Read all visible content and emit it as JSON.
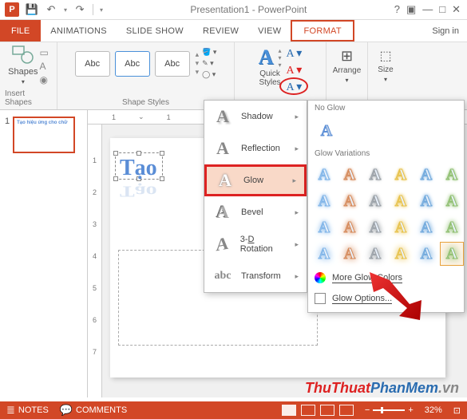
{
  "title": "Presentation1 - PowerPoint",
  "tabs": {
    "file": "FILE",
    "animations": "ANIMATIONS",
    "slideshow": "SLIDE SHOW",
    "review": "REVIEW",
    "view": "VIEW",
    "format": "FORMAT",
    "signin": "Sign in"
  },
  "ribbon": {
    "insert_shapes": "Insert Shapes",
    "shapes": "Shapes",
    "shape_styles": "Shape Styles",
    "style_sample": "Abc",
    "quick_styles": "Quick\nStyles",
    "arrange": "Arrange",
    "size": "Size"
  },
  "fx_menu": {
    "shadow": "Shadow",
    "reflection": "Reflection",
    "glow": "Glow",
    "bevel": "Bevel",
    "rotation": "3-D Rotation",
    "transform": "Transform"
  },
  "glow_panel": {
    "no_glow": "No Glow",
    "variations": "Glow Variations",
    "more_colors": "More Glow Colors",
    "options": "Glow Options...",
    "colors": [
      "#7fb4e8",
      "#d68a5a",
      "#9aa0a6",
      "#e8c24a",
      "#6fa8dc",
      "#8fbf6f"
    ]
  },
  "slide": {
    "number": "1",
    "sample_text": "Tạo",
    "thumb_text": "Tạo hiệu ứng cho chữ"
  },
  "ruler_h": [
    "1",
    "1"
  ],
  "ruler_v": [
    "1",
    "2",
    "3",
    "4",
    "5",
    "6",
    "7"
  ],
  "statusbar": {
    "notes": "NOTES",
    "comments": "COMMENTS",
    "zoom": "32%"
  },
  "watermark": {
    "a": "ThuThuat",
    "b": "PhanMem",
    "c": ".vn"
  }
}
